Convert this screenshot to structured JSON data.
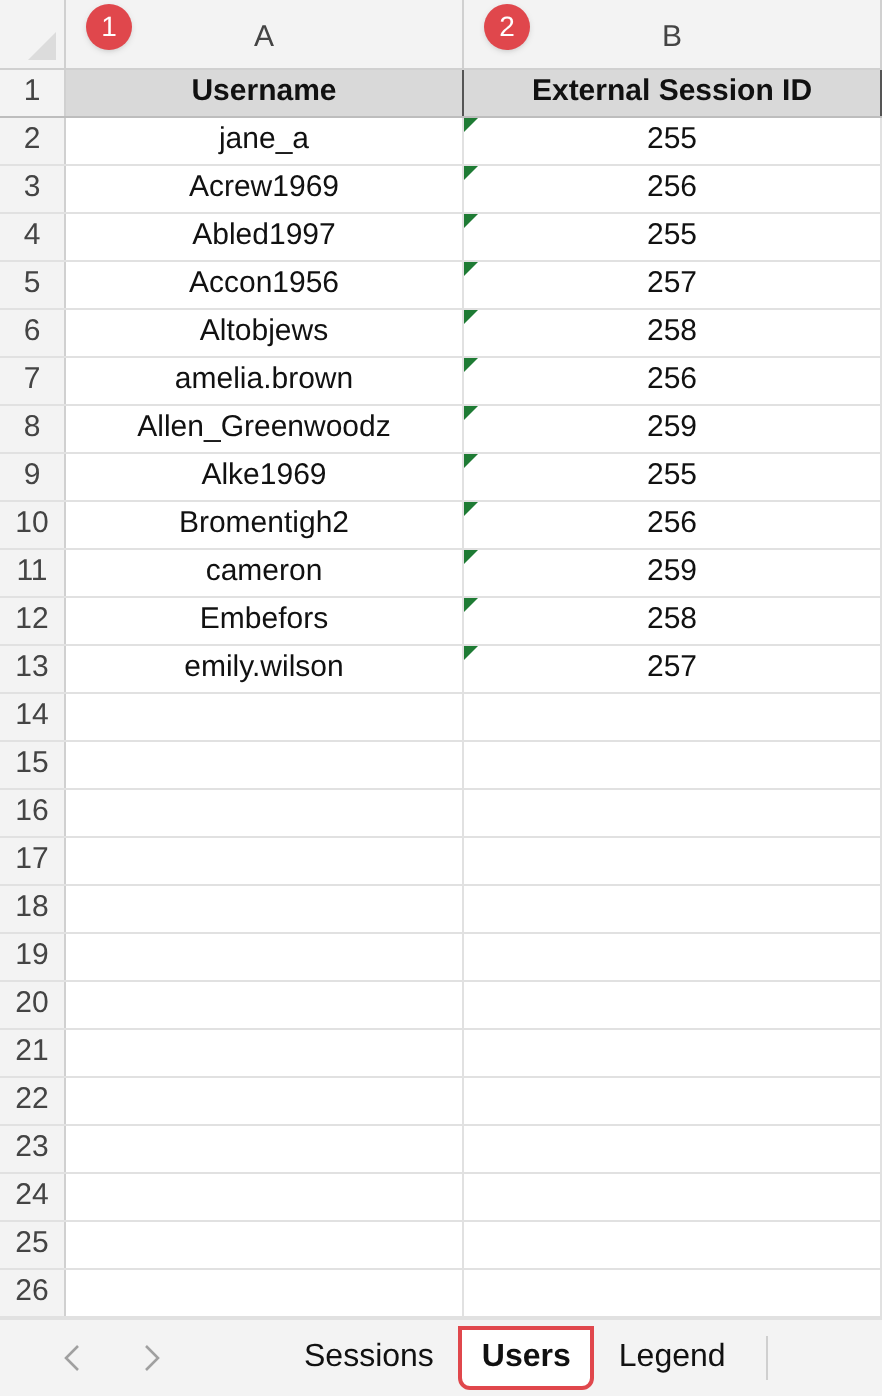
{
  "columns": [
    {
      "letter": "A",
      "badge": "1"
    },
    {
      "letter": "B",
      "badge": "2"
    }
  ],
  "header_row": {
    "number": "1",
    "cells": [
      "Username",
      "External Session ID"
    ]
  },
  "rows": [
    {
      "number": "2",
      "cells": [
        "jane_a",
        "255"
      ],
      "text_flag": true
    },
    {
      "number": "3",
      "cells": [
        "Acrew1969",
        "256"
      ],
      "text_flag": true
    },
    {
      "number": "4",
      "cells": [
        "Abled1997",
        "255"
      ],
      "text_flag": true
    },
    {
      "number": "5",
      "cells": [
        "Accon1956",
        "257"
      ],
      "text_flag": true
    },
    {
      "number": "6",
      "cells": [
        "Altobjews",
        "258"
      ],
      "text_flag": true
    },
    {
      "number": "7",
      "cells": [
        "amelia.brown",
        "256"
      ],
      "text_flag": true
    },
    {
      "number": "8",
      "cells": [
        "Allen_Greenwoodz",
        "259"
      ],
      "text_flag": true
    },
    {
      "number": "9",
      "cells": [
        "Alke1969",
        "255"
      ],
      "text_flag": true
    },
    {
      "number": "10",
      "cells": [
        "Bromentigh2",
        "256"
      ],
      "text_flag": true
    },
    {
      "number": "11",
      "cells": [
        "cameron",
        "259"
      ],
      "text_flag": true
    },
    {
      "number": "12",
      "cells": [
        "Embefors",
        "258"
      ],
      "text_flag": true
    },
    {
      "number": "13",
      "cells": [
        "emily.wilson",
        "257"
      ],
      "text_flag": true
    },
    {
      "number": "14",
      "cells": [],
      "text_flag": false
    },
    {
      "number": "15",
      "cells": [],
      "text_flag": false
    },
    {
      "number": "16",
      "cells": [],
      "text_flag": false
    },
    {
      "number": "17",
      "cells": [],
      "text_flag": false
    },
    {
      "number": "18",
      "cells": [],
      "text_flag": false
    },
    {
      "number": "19",
      "cells": [],
      "text_flag": false
    },
    {
      "number": "20",
      "cells": [],
      "text_flag": false
    },
    {
      "number": "21",
      "cells": [],
      "text_flag": false
    },
    {
      "number": "22",
      "cells": [],
      "text_flag": false
    },
    {
      "number": "23",
      "cells": [],
      "text_flag": false
    },
    {
      "number": "24",
      "cells": [],
      "text_flag": false
    },
    {
      "number": "25",
      "cells": [],
      "text_flag": false
    },
    {
      "number": "26",
      "cells": [],
      "text_flag": false
    }
  ],
  "sheet_tabs": [
    {
      "label": "Sessions",
      "selected": false,
      "highlighted": false
    },
    {
      "label": "Users",
      "selected": true,
      "highlighted": true
    },
    {
      "label": "Legend",
      "selected": false,
      "highlighted": false
    }
  ]
}
